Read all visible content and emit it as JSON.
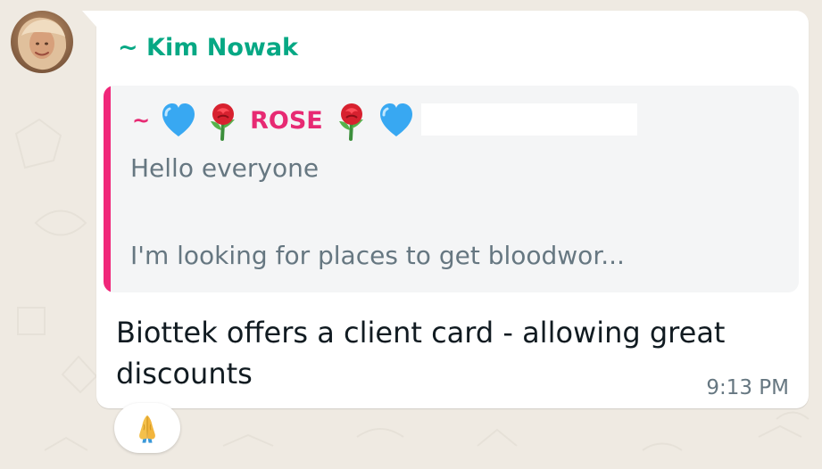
{
  "chat": {
    "sender_name": "~ Kim Nowak",
    "quoted": {
      "author_prefix": "~",
      "author_name": "ROSE",
      "author_emoji_sequence": [
        "blue-heart-icon",
        "rose-icon",
        "rose-icon",
        "blue-heart-icon"
      ],
      "preview_line_1": "Hello everyone",
      "preview_line_2": "I'm looking for places to get bloodwor..."
    },
    "message_text": "Biottek offers a client card - allowing great discounts",
    "timestamp": "9:13 PM",
    "reaction_icon": "folded-hands-icon"
  },
  "colors": {
    "wallpaper": "#efeae2",
    "bubble": "#ffffff",
    "sender_name": "#06a884",
    "quote_accent": "#f0277a",
    "quote_author": "#e72a73",
    "quote_text": "#667781",
    "message_text": "#111b21"
  }
}
